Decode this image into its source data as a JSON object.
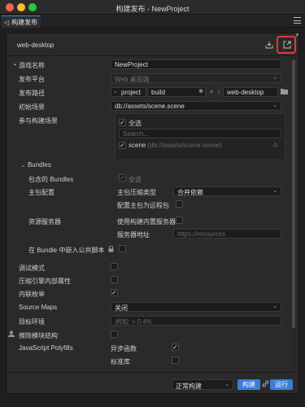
{
  "window": {
    "title": "构建发布 - NewProject"
  },
  "tabs": [
    {
      "label": "构建发布",
      "icon": "build-publish-icon"
    }
  ],
  "header": {
    "platform": "web-desktop",
    "icons": [
      "import-icon",
      "export-icon",
      "close-icon"
    ]
  },
  "form": {
    "game_name": {
      "label": "游戏名称",
      "value": "NewProject"
    },
    "platform": {
      "label": "发布平台",
      "value": "Web 桌面端"
    },
    "build_path": {
      "label": "发布路径",
      "scope": "project",
      "value": "build",
      "separator": "/",
      "suffix": "web-desktop"
    },
    "start_scene": {
      "label": "初始场景",
      "value": "db://assets/scene.scene"
    },
    "included_scenes": {
      "label": "参与构建场景",
      "select_all": "全选",
      "search_placeholder": "Search...",
      "items": [
        {
          "name": "scene",
          "path": "(db://assets/scene.scene)",
          "checked": true
        }
      ]
    },
    "bundles": {
      "label": "Bundles",
      "included": {
        "label": "包含的 Bundles",
        "value": "全选"
      },
      "main": {
        "label": "主包配置",
        "compression_label": "主包压缩类型",
        "compression_value": "合并依赖",
        "remote_label": "配置主包为远程包"
      },
      "resource_server": {
        "label": "资源服务器",
        "builtin_label": "使用构建内置服务器",
        "address_label": "服务器地址",
        "address_placeholder": "https://resources"
      },
      "embed_script": {
        "label": "在 Bundle 中嵌入公共脚本"
      }
    },
    "debug_mode": {
      "label": "调试模式"
    },
    "mangle_engine": {
      "label": "压缩引擎内部属性"
    },
    "inline_enum": {
      "label": "内联枚举",
      "checked": true
    },
    "source_maps": {
      "label": "Source Maps",
      "value": "关闭"
    },
    "target_env": {
      "label": "目标环境",
      "placeholder": "例如: > 0.4%"
    },
    "erase_modules": {
      "label": "擦除模块结构"
    },
    "polyfills": {
      "label": "JavaScript Polyfills",
      "async_label": "异步函数",
      "async_checked": true,
      "stdlib_label": "标准库"
    }
  },
  "footer": {
    "mode": "正常构建",
    "build_button": "构建",
    "run_button": "运行"
  },
  "colors": {
    "accent": "#3b7dd8",
    "highlight": "#e53935",
    "required": "#e0a030"
  }
}
